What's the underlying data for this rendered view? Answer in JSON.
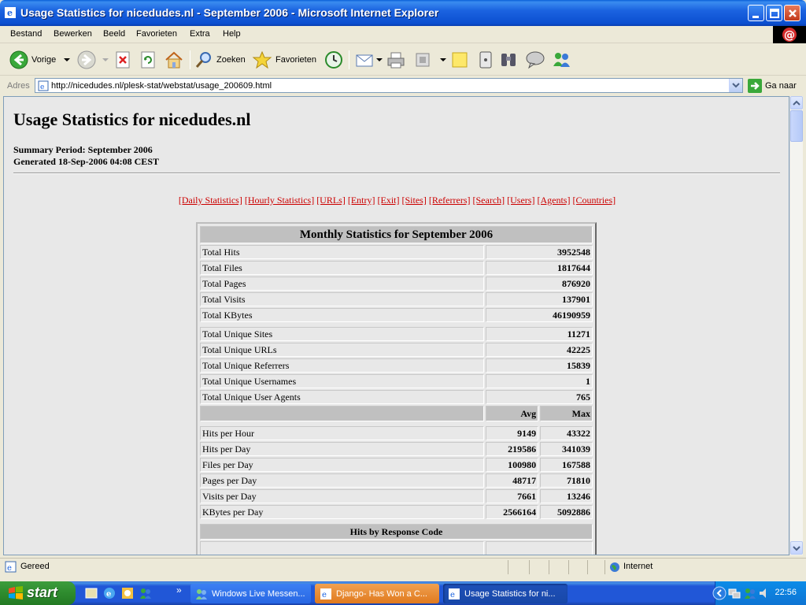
{
  "window": {
    "title": "Usage Statistics for nicedudes.nl - September 2006 - Microsoft Internet Explorer"
  },
  "menu": [
    "Bestand",
    "Bewerken",
    "Beeld",
    "Favorieten",
    "Extra",
    "Help"
  ],
  "toolbar": {
    "back_label": "Vorige",
    "search_label": "Zoeken",
    "favorites_label": "Favorieten"
  },
  "address": {
    "label": "Adres",
    "url": "http://nicedudes.nl/plesk-stat/webstat/usage_200609.html",
    "go_label": "Ga naar"
  },
  "page": {
    "title": "Usage Statistics for nicedudes.nl",
    "summary_period": "Summary Period: September 2006",
    "generated": "Generated 18-Sep-2006 04:08 CEST",
    "nav_links": [
      "[Daily Statistics]",
      "[Hourly Statistics]",
      "[URLs]",
      "[Entry]",
      "[Exit]",
      "[Sites]",
      "[Referrers]",
      "[Search]",
      "[Users]",
      "[Agents]",
      "[Countries]"
    ]
  },
  "stats": {
    "heading": "Monthly Statistics for September 2006",
    "totals": [
      {
        "label": "Total Hits",
        "value": "3952548"
      },
      {
        "label": "Total Files",
        "value": "1817644"
      },
      {
        "label": "Total Pages",
        "value": "876920"
      },
      {
        "label": "Total Visits",
        "value": "137901"
      },
      {
        "label": "Total KBytes",
        "value": "46190959"
      }
    ],
    "uniques": [
      {
        "label": "Total Unique Sites",
        "value": "11271"
      },
      {
        "label": "Total Unique URLs",
        "value": "42225"
      },
      {
        "label": "Total Unique Referrers",
        "value": "15839"
      },
      {
        "label": "Total Unique Usernames",
        "value": "1"
      },
      {
        "label": "Total Unique User Agents",
        "value": "765"
      }
    ],
    "avg_header": "Avg",
    "max_header": "Max",
    "rates": [
      {
        "label": "Hits per Hour",
        "avg": "9149",
        "max": "43322"
      },
      {
        "label": "Hits per Day",
        "avg": "219586",
        "max": "341039"
      },
      {
        "label": "Files per Day",
        "avg": "100980",
        "max": "167588"
      },
      {
        "label": "Pages per Day",
        "avg": "48717",
        "max": "71810"
      },
      {
        "label": "Visits per Day",
        "avg": "7661",
        "max": "13246"
      },
      {
        "label": "KBytes per Day",
        "avg": "2566164",
        "max": "5092886"
      }
    ],
    "response_heading": "Hits by Response Code"
  },
  "status": {
    "text": "Gereed",
    "zone": "Internet"
  },
  "taskbar": {
    "start_label": "start",
    "tasks": [
      "Windows Live Messen...",
      "Django- Has Won a C...",
      "Usage Statistics for ni..."
    ],
    "clock": "22:56"
  }
}
